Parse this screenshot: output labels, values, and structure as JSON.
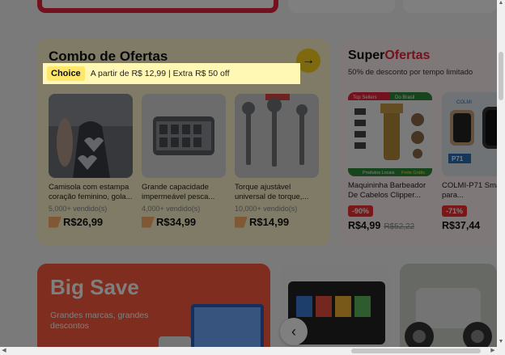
{
  "combo": {
    "title": "Combo de Ofertas",
    "choice_badge": "Choice",
    "choice_text": "A partir de R$ 12,99 | Extra R$ 50 off",
    "products": [
      {
        "name": "Camisola com estampa coração feminino, gola...",
        "sold": "5,000+ vendido(s)",
        "price": "R$26,99"
      },
      {
        "name": "Grande capacidade impermeável pesca...",
        "sold": "4,000+ vendido(s)",
        "price": "R$34,99"
      },
      {
        "name": "Torque ajustável universal de torque,...",
        "sold": "10,000+ vendido(s)",
        "price": "R$14,99"
      }
    ]
  },
  "super": {
    "title_a": "Super",
    "title_b": "Ofertas",
    "subtitle": "50% de desconto por tempo limitado",
    "products": [
      {
        "name": "Maquininha Barbeador De Cabelos Clipper...",
        "discount": "-90%",
        "price": "R$4,99",
        "old_price": "R$52,22",
        "tags": [
          "Top Sellers",
          "Do Brasil",
          "Produtos Locais",
          "Frete Grátis"
        ]
      },
      {
        "name": "COLMI-P71 Smartwatch para...",
        "discount": "-71%",
        "price": "R$37,44",
        "old_price": "",
        "tags": [
          "COLMI",
          "P71"
        ]
      }
    ]
  },
  "bigsave": {
    "title": "Big Save",
    "subtitle": "Grandes marcas, grandes descontos"
  },
  "colors": {
    "accent_red": "#e8223c",
    "choice_yellow": "#ffe76a",
    "combo_bg": "#fff6cf"
  }
}
